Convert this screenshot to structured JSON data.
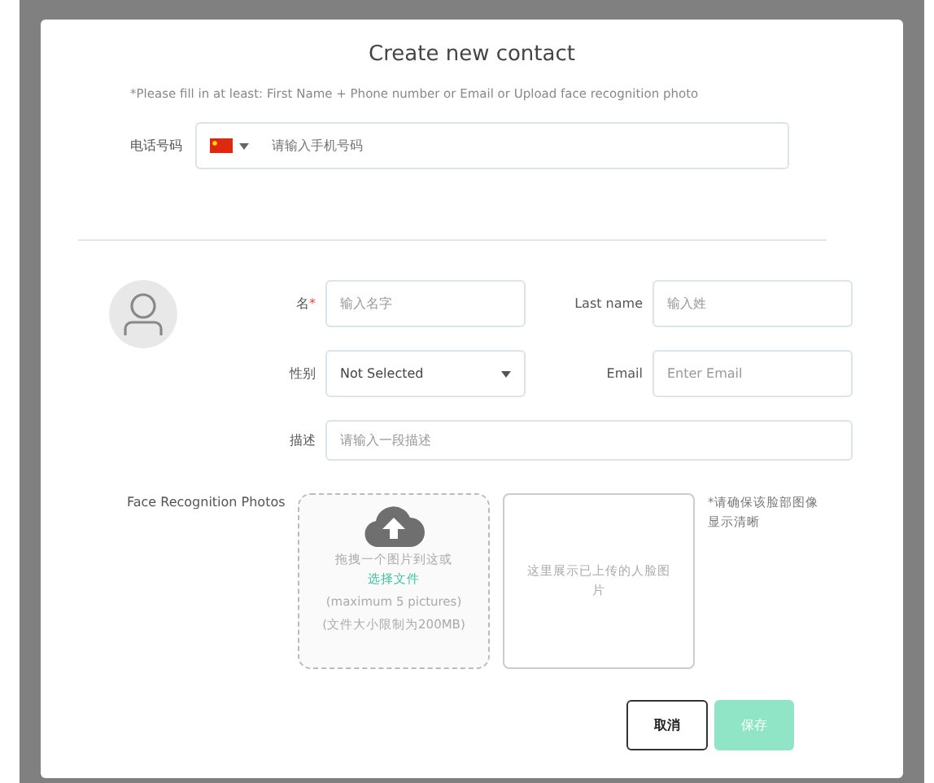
{
  "dialog": {
    "title": "Create new contact",
    "hint": "*Please fill in at least: First Name + Phone number or Email or Upload face recognition photo"
  },
  "phone": {
    "label": "电话号码",
    "placeholder": "请输入手机号码"
  },
  "fields": [
    {
      "kind": "input",
      "label": "名",
      "required_mark": "*",
      "placeholder": "输入名字"
    },
    {
      "kind": "input",
      "label": "Last name",
      "placeholder": "输入姓"
    },
    {
      "kind": "select",
      "label": "性别",
      "value": "Not Selected"
    },
    {
      "kind": "input",
      "label": "Email",
      "placeholder": "Enter Email"
    },
    {
      "kind": "wide_input",
      "label": "描述",
      "placeholder": "请输入一段描述"
    }
  ],
  "photos": {
    "label": "Face Recognition Photos",
    "drop_text": "拖拽一个图片到这或",
    "choose_link": "选择文件",
    "max_note": "(maximum 5 pictures)",
    "size_note": "(文件大小限制为200MB)",
    "preview_text": "这里展示已上传的人脸图片",
    "tip": "*请确保该脸部图像显示清晰"
  },
  "buttons": [
    {
      "label": "取消",
      "kind": "cancel",
      "disabled": false
    },
    {
      "label": "保存",
      "kind": "save",
      "disabled": true
    }
  ]
}
